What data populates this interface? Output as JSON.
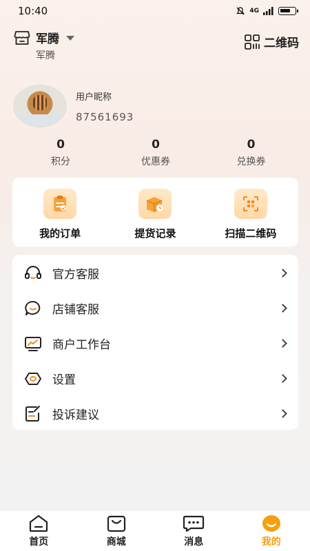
{
  "status_bar": {
    "time": "10:40",
    "network": "4G"
  },
  "header": {
    "store_name": "军腾",
    "store_sub": "军腾",
    "qr_label": "二维码"
  },
  "profile": {
    "nickname": "用户昵称",
    "id": "87561693"
  },
  "stats": [
    {
      "value": "0",
      "label": "积分"
    },
    {
      "value": "0",
      "label": "优惠券"
    },
    {
      "value": "0",
      "label": "兑换券"
    }
  ],
  "quick_actions": [
    {
      "label": "我的订单",
      "icon": "clipboard-icon"
    },
    {
      "label": "提货记录",
      "icon": "box-clock-icon"
    },
    {
      "label": "扫描二维码",
      "icon": "scan-icon"
    }
  ],
  "menu": [
    {
      "label": "官方客服",
      "icon": "headset-icon"
    },
    {
      "label": "店铺客服",
      "icon": "chat-smile-icon"
    },
    {
      "label": "商户工作台",
      "icon": "monitor-chart-icon"
    },
    {
      "label": "设置",
      "icon": "settings-hex-icon"
    },
    {
      "label": "投诉建议",
      "icon": "edit-note-icon"
    }
  ],
  "tabbar": [
    {
      "label": "首页",
      "icon": "home-icon",
      "active": false
    },
    {
      "label": "商城",
      "icon": "shopping-bag-icon",
      "active": false
    },
    {
      "label": "消息",
      "icon": "message-icon",
      "active": false
    },
    {
      "label": "我的",
      "icon": "profile-smile-icon",
      "active": true
    }
  ],
  "colors": {
    "accent": "#f5a00f",
    "icon_orange": "#f08a1c"
  }
}
